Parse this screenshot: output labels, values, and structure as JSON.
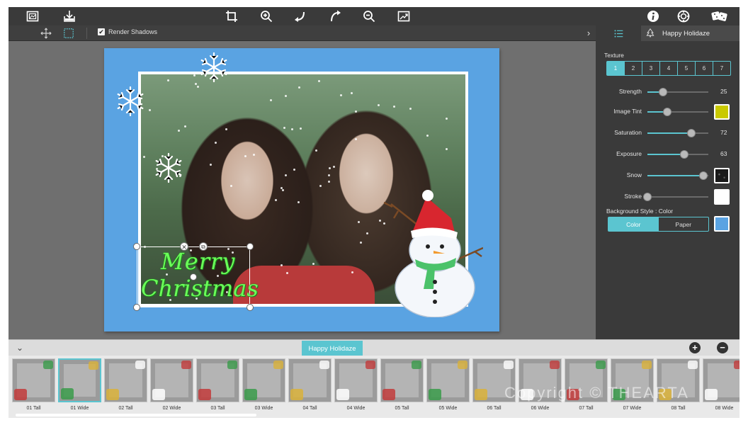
{
  "toolbar": {
    "icons": [
      "gallery-icon",
      "save-icon",
      "crop-icon",
      "zoom-in-icon",
      "rotate-left-icon",
      "rotate-right-icon",
      "zoom-out-icon",
      "export-image-icon",
      "info-icon",
      "settings-icon",
      "dice-icon"
    ]
  },
  "subtoolbar": {
    "render_shadows_label": "Render Shadows",
    "render_shadows_checked": true
  },
  "panel": {
    "theme_tab_label": "Happy Holidaze",
    "texture_label": "Texture",
    "texture_options": [
      "1",
      "2",
      "3",
      "4",
      "5",
      "6",
      "7"
    ],
    "texture_selected": "1",
    "sliders": [
      {
        "label": "Strength",
        "value": "25",
        "fraction": 0.25
      },
      {
        "label": "Image Tint",
        "value": "",
        "fraction": 0.32,
        "swatch": "#c9c900"
      },
      {
        "label": "Saturation",
        "value": "72",
        "fraction": 0.72
      },
      {
        "label": "Exposure",
        "value": "63",
        "fraction": 0.6
      },
      {
        "label": "Snow",
        "value": "",
        "fraction": 0.92,
        "swatch": "#1a1a1a"
      },
      {
        "label": "Stroke",
        "value": "",
        "fraction": 0.0,
        "swatch": "#ffffff"
      }
    ],
    "background_style_label": "Background Style : Color",
    "background_style_options": [
      "Color",
      "Paper"
    ],
    "background_style_selected": "Color",
    "background_color": "#5aa3e2"
  },
  "canvas": {
    "text_line1": "Merry",
    "text_line2": "Christmas",
    "page_color": "#5aa3e2"
  },
  "strip": {
    "tab_label": "Happy Holidaze",
    "thumbnails": [
      "01 Tall",
      "01 Wide",
      "02 Tall",
      "02 Wide",
      "03 Tall",
      "03 Wide",
      "04 Tall",
      "04 Wide",
      "05 Tall",
      "05 Wide",
      "06 Tall",
      "06 Wide",
      "07 Tall",
      "07 Wide",
      "08 Tall",
      "08 Wide"
    ],
    "selected_index": 1,
    "watermark": "Copyright © THEARTA"
  },
  "colors": {
    "accent": "#5bc5d0",
    "panel": "#3a3a3a"
  }
}
